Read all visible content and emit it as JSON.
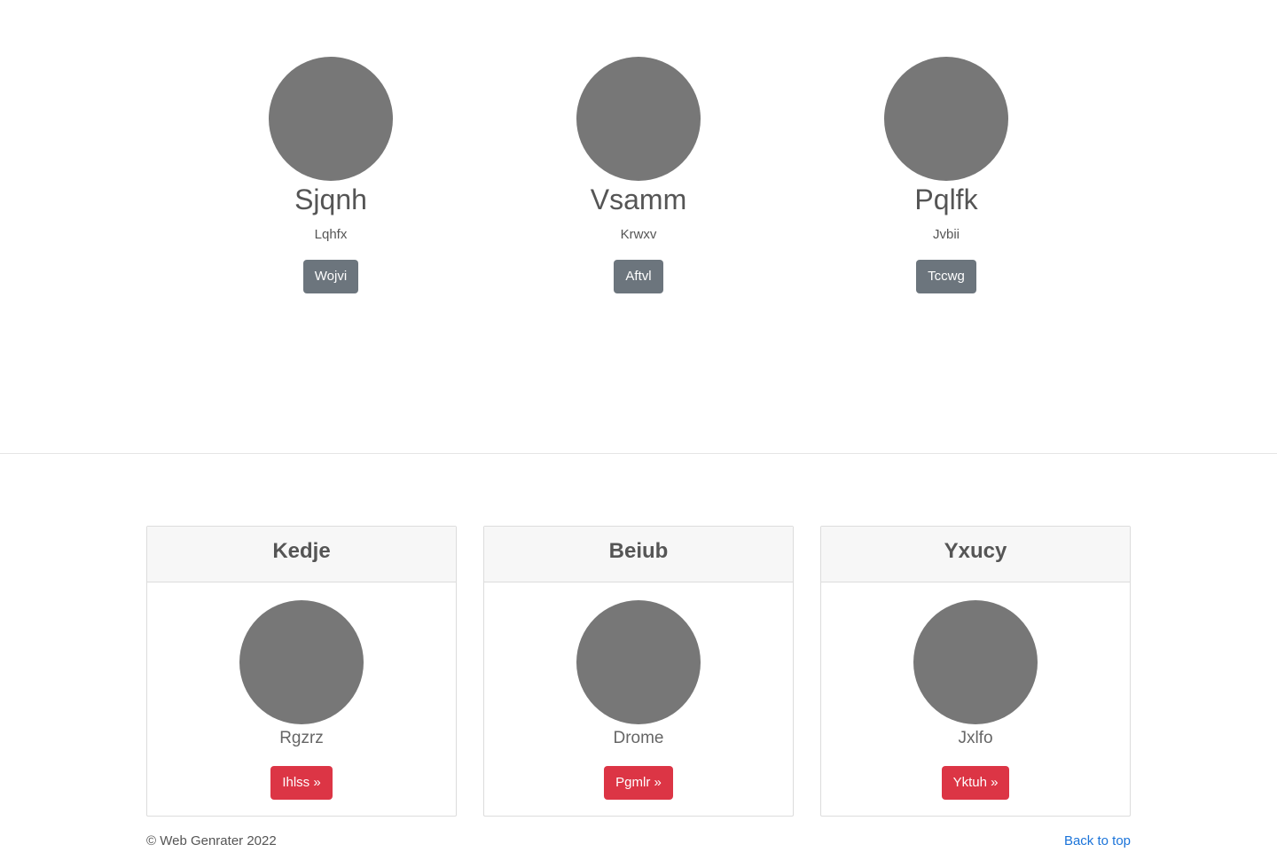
{
  "profiles": [
    {
      "name": "Sjqnh",
      "subtitle": "Lqhfx",
      "button_label": "Wojvi"
    },
    {
      "name": "Vsamm",
      "subtitle": "Krwxv",
      "button_label": "Aftvl"
    },
    {
      "name": "Pqlfk",
      "subtitle": "Jvbii",
      "button_label": "Tccwg"
    }
  ],
  "cards": [
    {
      "header": "Kedje",
      "text": "Rgzrz",
      "button_label": "Ihlss »"
    },
    {
      "header": "Beiub",
      "text": "Drome",
      "button_label": "Pgmlr »"
    },
    {
      "header": "Yxucy",
      "text": "Jxlfo",
      "button_label": "Yktuh »"
    }
  ],
  "footer": {
    "copyright": "© Web Genrater 2022",
    "back_to_top": "Back to top"
  },
  "colors": {
    "avatar": "#777777",
    "gray_button": "#6c757d",
    "red_button": "#dc3545",
    "link": "#1a73d9"
  }
}
